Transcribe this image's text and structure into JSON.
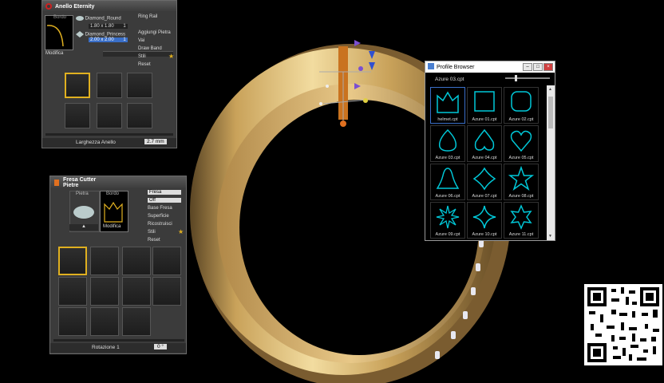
{
  "panel_anello": {
    "title": "Anello Eternity",
    "thumb_label": "Bordo",
    "edit_label": "Modifica",
    "stones": [
      {
        "name": "Diamond_Round",
        "size": "1.80 x 1.80",
        "qty": "1"
      },
      {
        "name": "Diamond_Princess",
        "size": "2.00 x 2.00",
        "qty": "1"
      }
    ],
    "side_items": [
      "Ring Rail",
      "Aggiungi Pietra",
      "Vai",
      "Draw Band",
      "Stili",
      "Reset"
    ],
    "footer_label": "Larghezza Anello",
    "footer_value": "2.7 mm"
  },
  "panel_fresa": {
    "title": "Fresa Cutter\nPietre",
    "tab1": "Pietra",
    "tab2": "Bordo",
    "edit_label": "Modifica",
    "menu": [
      "Fresa",
      "Off",
      "Base Fresa",
      "Superficie",
      "Ricostruisci",
      "Stili",
      "Reset"
    ],
    "footer_label": "Rotazione 1",
    "footer_value": "0 °"
  },
  "profile_browser": {
    "title": "Profile Browser",
    "selected": "Azure 03.cpt",
    "items": [
      "helmet.cpt",
      "Azure 01.cpt",
      "Azure 02.cpt",
      "Azure 03.cpt",
      "Azure 04.cpt",
      "Azure 05.cpt",
      "Azure 06.cpt",
      "Azure 07.cpt",
      "Azure 08.cpt",
      "Azure 09.cpt",
      "Azure 10.cpt",
      "Azure 11.cpt"
    ]
  },
  "colors": {
    "gold": "#c9a25a",
    "accent": "#e0b020",
    "profile": "#00c8d8"
  }
}
